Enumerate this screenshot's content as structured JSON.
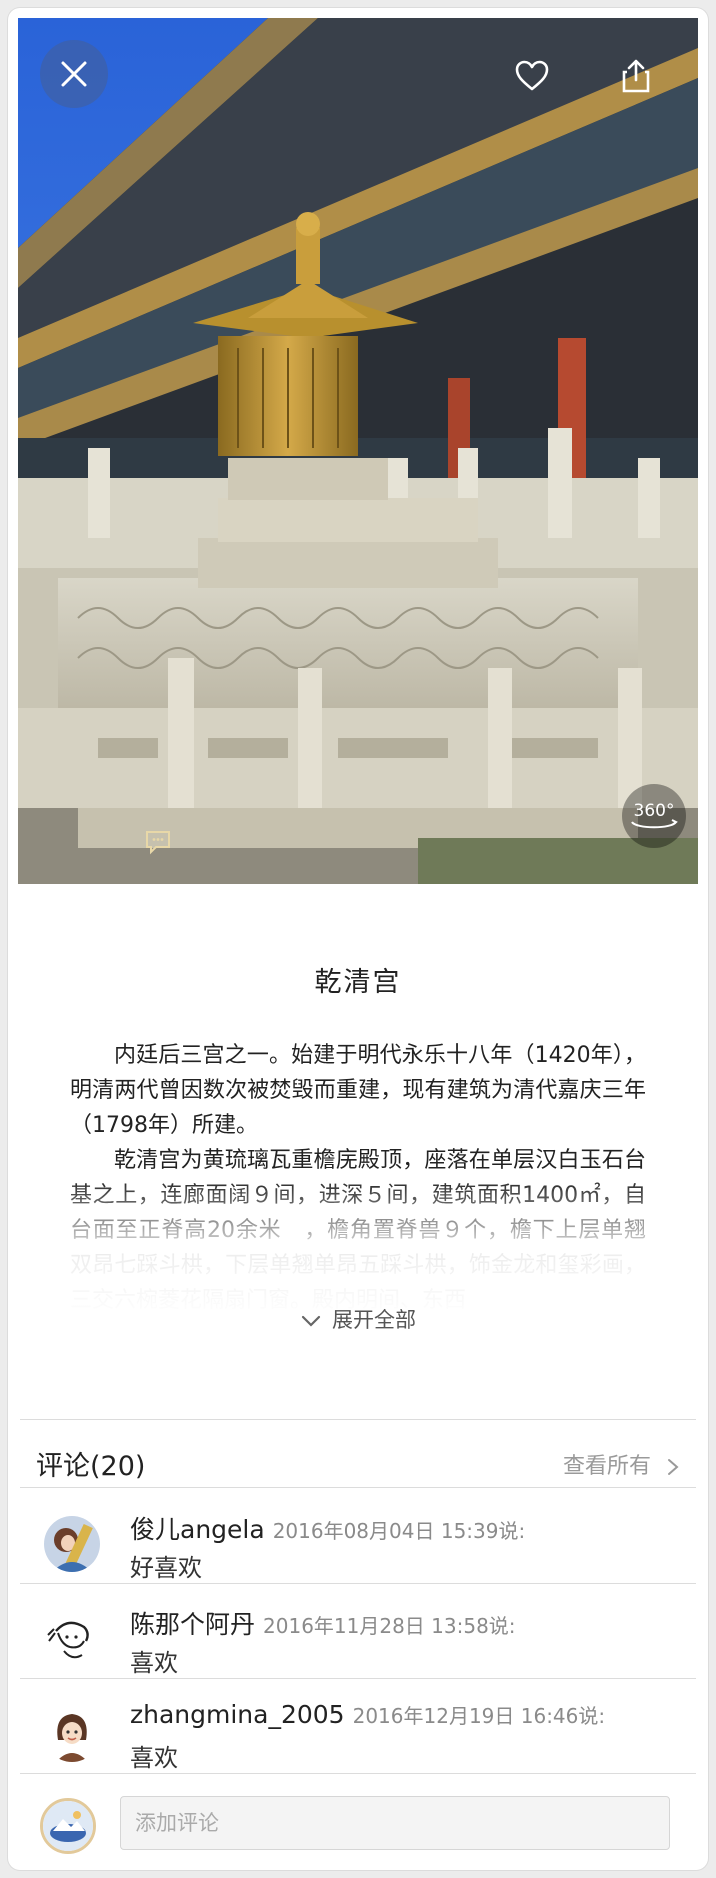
{
  "hero": {
    "close_icon": "close-icon",
    "favorite_icon": "heart-icon",
    "share_icon": "share-icon",
    "pano_label": "360°",
    "hotspot_icon": "comment-bubble-icon"
  },
  "title": "乾清宫",
  "description": {
    "paragraphs": [
      "内廷后三宫之一。始建于明代永乐十八年（1420年），明清两代曾因数次被焚毁而重建，现有建筑为清代嘉庆三年（1798年）所建。",
      "乾清宫为黄琉璃瓦重檐庑殿顶，座落在单层汉白玉石台基之上，连廊面阔９间，进深５间，建筑面积1400㎡，自台面至正脊高20余米　，檐角置脊兽９个，檐下上层单翘双昂七踩斗栱，下层单翘单昂五踩斗栱，饰金龙和玺彩画，三交六椀菱花隔扇门窗。殿内明间、东西"
    ],
    "expand_label": "展开全部"
  },
  "comments": {
    "header": "评论(20)",
    "view_all": "查看所有",
    "items": [
      {
        "name": "俊儿angela",
        "time": "2016年08月04日 15:39说:",
        "text": "好喜欢"
      },
      {
        "name": "陈那个阿丹",
        "time": "2016年11月28日 13:58说:",
        "text": "喜欢"
      },
      {
        "name": "zhangmina_2005",
        "time": "2016年12月19日 16:46说:",
        "text": "喜欢"
      }
    ]
  },
  "input": {
    "placeholder": "添加评论"
  }
}
